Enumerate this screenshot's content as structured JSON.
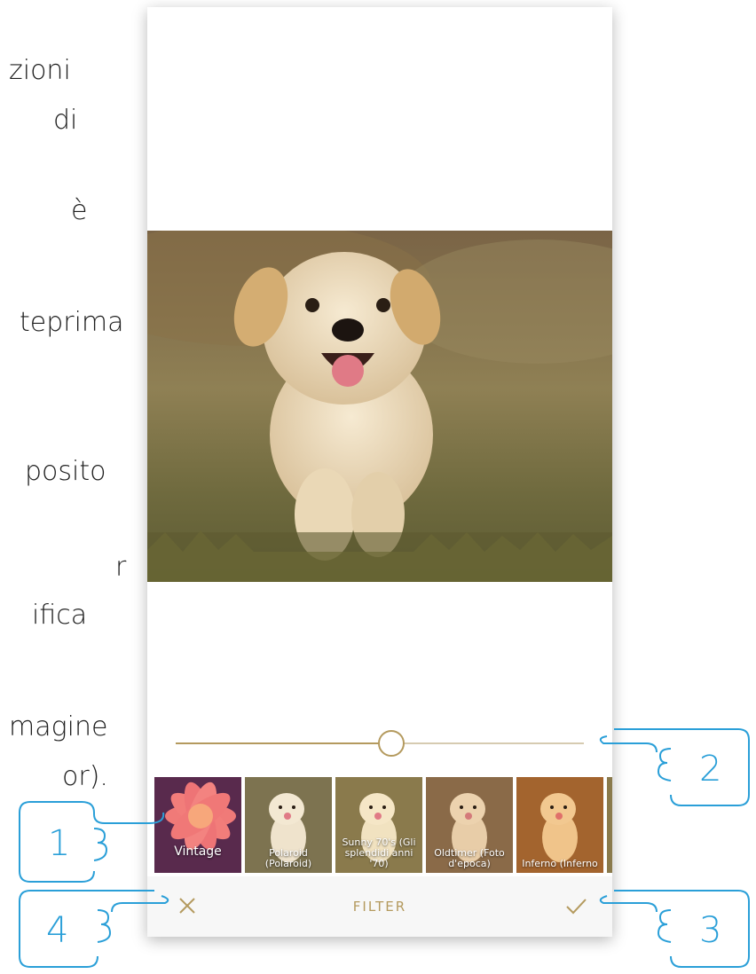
{
  "left_text_fragments": [
    "zioni",
    "di",
    "è",
    "teprima",
    "posito",
    "r",
    "ifica",
    "magine",
    "or)."
  ],
  "editor": {
    "bottom_bar_title": "FILTER",
    "cancel_icon": "close-icon",
    "confirm_icon": "checkmark-icon",
    "accent_color": "#b49a5e",
    "slider_value_fraction": 0.49
  },
  "filters": [
    {
      "label": "Vintage"
    },
    {
      "label": "Polaroid (Polaroid)"
    },
    {
      "label": "Sunny 70's (Gli splendidi anni '70)"
    },
    {
      "label": "Oldtimer (Foto d'epoca)"
    },
    {
      "label": "Inferno (Inferno"
    }
  ],
  "callouts": [
    {
      "number": "1"
    },
    {
      "number": "2"
    },
    {
      "number": "3"
    },
    {
      "number": "4"
    }
  ],
  "callout_color": "#2a9fd8"
}
